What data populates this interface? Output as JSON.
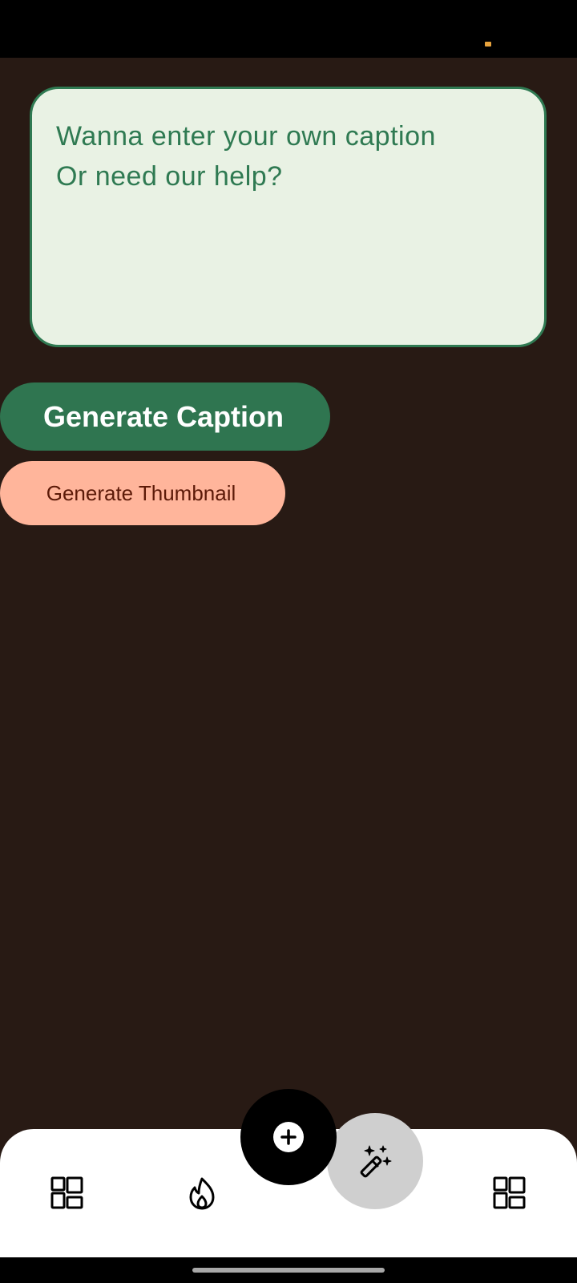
{
  "caption_input": {
    "placeholder_line1": "Wanna enter your own caption",
    "placeholder_line2": "Or need our help?"
  },
  "buttons": {
    "generate_caption": "Generate Caption",
    "generate_thumbnail": "Generate Thumbnail"
  },
  "nav": {
    "items": [
      {
        "icon": "dashboard-icon",
        "active": false
      },
      {
        "icon": "fire-icon",
        "active": false
      },
      {
        "icon": "magic-wand-icon",
        "active": true
      },
      {
        "icon": "dashboard-icon",
        "active": false
      }
    ],
    "fab_icon": "add-icon"
  },
  "colors": {
    "background": "#281a14",
    "caption_box_bg": "#e9f2e4",
    "caption_accent": "#2f7a52",
    "primary_button": "#2f7550",
    "secondary_button": "#ffb59b",
    "secondary_button_text": "#5c1a08",
    "nav_active": "#cfcfcf"
  }
}
